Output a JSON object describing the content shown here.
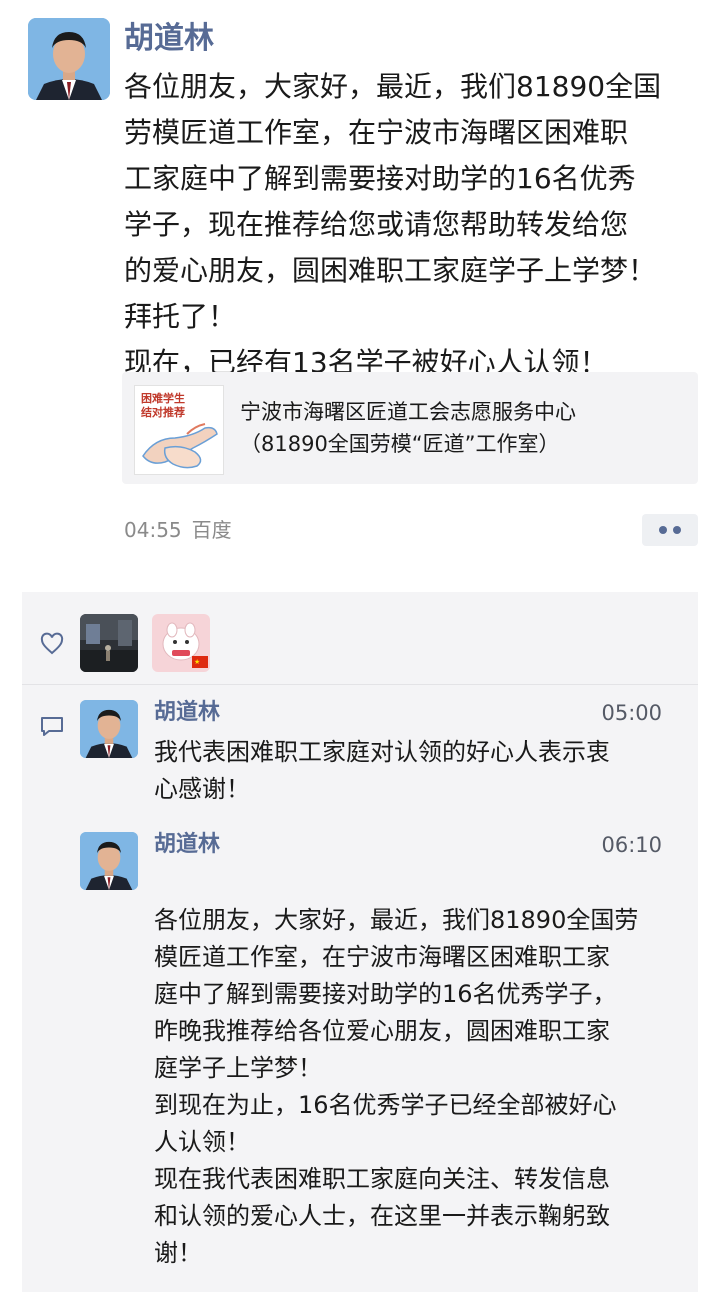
{
  "post": {
    "author": "胡道林",
    "lines": [
      "各位朋友，大家好，最近，我们81890全国",
      "劳模匠道工作室，在宁波市海曙区困难职",
      "工家庭中了解到需要接对助学的16名优秀",
      "学子，现在推荐给您或请您帮助转发给您",
      "的爱心朋友，圆困难职工家庭学子上学梦！",
      "拜托了！",
      "现在，已经有13名学子被好心人认领！"
    ],
    "link_card": {
      "thumb_text_line1": "困难学生",
      "thumb_text_line2": "结对推荐",
      "title_line1": "宁波市海曙区匠道工会志愿服务中心",
      "title_line2": "（81890全国劳模“匠道”工作室）"
    },
    "time": "04:55",
    "source": "百度",
    "more_icon": "more-dots-icon"
  },
  "interactions": {
    "like_icon": "heart-icon",
    "comment_icon": "comment-bubble-icon",
    "likers": [
      "liker-1",
      "liker-2"
    ],
    "comments": [
      {
        "author": "胡道林",
        "time": "05:00",
        "lines": [
          "我代表困难职工家庭对认领的好心人表示衷",
          "心感谢！"
        ]
      },
      {
        "author": "胡道林",
        "time": "06:10",
        "lines": [
          "各位朋友，大家好，最近，我们81890全国劳",
          "模匠道工作室，在宁波市海曙区困难职工家",
          "庭中了解到需要接对助学的16名优秀学子，",
          "昨晚我推荐给各位爱心朋友，圆困难职工家",
          "庭学子上学梦！",
          "到现在为止，16名优秀学子已经全部被好心",
          "人认领！",
          "现在我代表困难职工家庭向关注、转发信息",
          "和认领的爱心人士，在这里一并表示鞠躬致",
          "谢！"
        ]
      }
    ]
  },
  "colors": {
    "name_blue": "#576b95",
    "panel_bg": "#f4f4f6",
    "time_gray": "#8a8a8a"
  }
}
